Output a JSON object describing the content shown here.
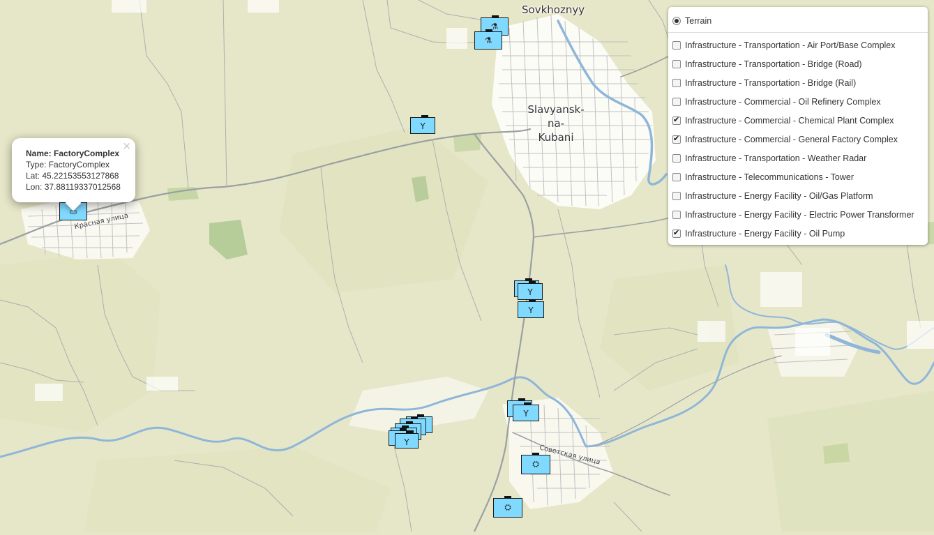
{
  "map": {
    "city_labels": [
      {
        "name": "Sovkhoznyy"
      },
      {
        "name": "Slavyansk-\nna-\nKubani"
      }
    ],
    "street_labels": [
      "Красная улица",
      "Советская улица"
    ],
    "colors": {
      "land": "#e6e7c8",
      "water": "#8fb6d9",
      "road": "#9aa0a3",
      "urban": "#ffffff",
      "vegetation": "#a6c38a",
      "marker_fill": "#80d9ff"
    }
  },
  "markers": [
    {
      "type": "chemical",
      "icon": "chemical-plant-icon"
    },
    {
      "type": "chemical",
      "icon": "chemical-plant-icon"
    },
    {
      "type": "pump",
      "icon": "oil-pump-icon"
    },
    {
      "type": "factory",
      "icon": "factory-icon"
    },
    {
      "type": "pump",
      "icon": "oil-pump-icon"
    },
    {
      "type": "pump",
      "icon": "oil-pump-icon"
    },
    {
      "type": "pump",
      "icon": "oil-pump-icon"
    },
    {
      "type": "pump",
      "icon": "oil-pump-icon"
    },
    {
      "type": "pump",
      "icon": "oil-pump-icon"
    },
    {
      "type": "pump",
      "icon": "oil-pump-icon"
    },
    {
      "type": "pump",
      "icon": "oil-pump-icon"
    },
    {
      "type": "pump",
      "icon": "oil-pump-icon"
    },
    {
      "type": "pump",
      "icon": "oil-pump-icon"
    },
    {
      "type": "pump",
      "icon": "oil-pump-icon"
    },
    {
      "type": "pump",
      "icon": "oil-pump-icon"
    },
    {
      "type": "factory",
      "icon": "factory-icon"
    },
    {
      "type": "factory",
      "icon": "factory-icon"
    }
  ],
  "popup": {
    "name_label": "Name:",
    "name_value": "FactoryComplex",
    "type_label": "Type:",
    "type_value": "FactoryComplex",
    "lat_label": "Lat:",
    "lat_value": "45.22153553127868",
    "lon_label": "Lon:",
    "lon_value": "37.88119337012568",
    "close": "×"
  },
  "layers": {
    "base": [
      {
        "label": "Terrain",
        "selected": true
      }
    ],
    "overlays": [
      {
        "label": "Infrastructure - Transportation - Air Port/Base Complex",
        "checked": false
      },
      {
        "label": "Infrastructure - Transportation - Bridge (Road)",
        "checked": false
      },
      {
        "label": "Infrastructure - Transportation - Bridge (Rail)",
        "checked": false
      },
      {
        "label": "Infrastructure - Commercial - Oil Refinery Complex",
        "checked": false
      },
      {
        "label": "Infrastructure - Commercial - Chemical Plant Complex",
        "checked": true
      },
      {
        "label": "Infrastructure - Commercial - General Factory Complex",
        "checked": true
      },
      {
        "label": "Infrastructure - Transportation - Weather Radar",
        "checked": false
      },
      {
        "label": "Infrastructure - Telecommunications - Tower",
        "checked": false
      },
      {
        "label": "Infrastructure - Energy Facility - Oil/Gas Platform",
        "checked": false
      },
      {
        "label": "Infrastructure - Energy Facility - Electric Power Transformer",
        "checked": false
      },
      {
        "label": "Infrastructure - Energy Facility - Oil Pump",
        "checked": true
      }
    ]
  }
}
